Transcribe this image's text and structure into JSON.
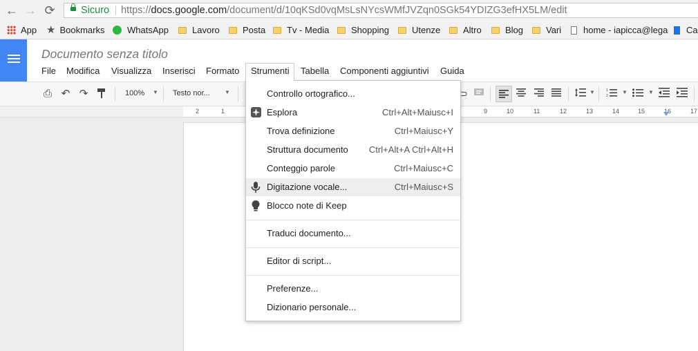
{
  "browser": {
    "back_icon": "←",
    "forward_icon": "→",
    "reload_icon": "⟳",
    "secure_label": "Sicuro",
    "url_scheme": "https://",
    "url_host": "docs.google.com",
    "url_path": "/document/d/10qKSd0vqMsLsNYcsWMfJVZqn0SGk54YDIZG3efHX5LM/edit"
  },
  "bookmarks": {
    "apps": "App",
    "bookmarks": "Bookmarks",
    "whatsapp": "WhatsApp",
    "lavoro": "Lavoro",
    "posta": "Posta",
    "tv": "Tv - Media",
    "shopping": "Shopping",
    "utenze": "Utenze",
    "altro": "Altro",
    "blog": "Blog",
    "vari": "Vari",
    "home": "home - iapicca@lega",
    "ca": "Ca"
  },
  "docs": {
    "title": "Documento senza titolo",
    "menus": [
      "File",
      "Modifica",
      "Visualizza",
      "Inserisci",
      "Formato",
      "Strumenti",
      "Tabella",
      "Componenti aggiuntivi",
      "Guida"
    ]
  },
  "toolbar": {
    "zoom": "100%",
    "style": "Testo nor...",
    "ruler": [
      "2",
      "1",
      "9",
      "10",
      "11",
      "12",
      "13",
      "14",
      "15",
      "16",
      "17"
    ]
  },
  "strumenti_menu": {
    "items": [
      {
        "label": "Controllo ortografico...",
        "shortcut": ""
      },
      {
        "label": "Esplora",
        "shortcut": "Ctrl+Alt+Maiusc+I",
        "icon": "explore-icon"
      },
      {
        "label": "Trova definizione",
        "shortcut": "Ctrl+Maiusc+Y"
      },
      {
        "label": "Struttura documento",
        "shortcut": "Ctrl+Alt+A Ctrl+Alt+H"
      },
      {
        "label": "Conteggio parole",
        "shortcut": "Ctrl+Maiusc+C"
      },
      {
        "label": "Digitazione vocale...",
        "shortcut": "Ctrl+Maiusc+S",
        "icon": "microphone-icon"
      },
      {
        "label": "Blocco note di Keep",
        "shortcut": "",
        "icon": "lightbulb-icon"
      },
      {
        "label": "Traduci documento...",
        "shortcut": ""
      },
      {
        "label": "Editor di script...",
        "shortcut": ""
      },
      {
        "label": "Preferenze...",
        "shortcut": ""
      },
      {
        "label": "Dizionario personale...",
        "shortcut": ""
      }
    ]
  },
  "colors": {
    "docs_blue": "#4285f4",
    "secure_green": "#1e8e3e",
    "highlight": "#eeeeee"
  }
}
